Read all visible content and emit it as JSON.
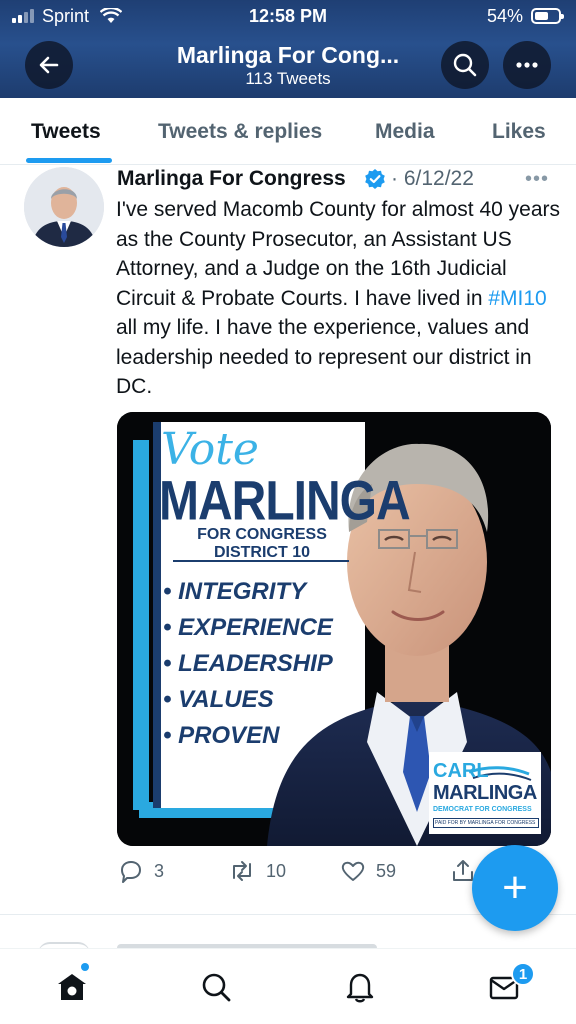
{
  "status_bar": {
    "carrier": "Sprint",
    "time": "12:58 PM",
    "battery": "54%"
  },
  "header": {
    "title": "Marlinga For Cong...",
    "subtitle": "113 Tweets"
  },
  "tabs": [
    {
      "label": "Tweets",
      "active": true
    },
    {
      "label": "Tweets & replies",
      "active": false
    },
    {
      "label": "Media",
      "active": false
    },
    {
      "label": "Likes",
      "active": false
    }
  ],
  "tweet": {
    "author": "Marlinga For Congress",
    "date": "· 6/12/22",
    "more": "•••",
    "text_before": "I've served Macomb County for almost 40 years as the County Prosecutor, an Assistant US Attorney, and a Judge on the 16th Judicial Circuit & Probate Courts. I have lived in ",
    "hashtag": "#MI10",
    "text_after": " all my life. I have the experience, values and leadership needed to represent our district in DC.",
    "media": {
      "vote": "Vote",
      "name": "MARLINGA",
      "subtitle": "FOR CONGRESS DISTRICT 10",
      "bullets": [
        "INTEGRITY",
        "EXPERIENCE",
        "LEADERSHIP",
        "VALUES",
        "PROVEN"
      ],
      "logo_line1": "CARL",
      "logo_line2": "MARLINGA",
      "logo_line3": "DEMOCRAT FOR CONGRESS",
      "logo_line4": "PAID FOR BY MARLINGA FOR CONGRESS"
    },
    "actions": {
      "replies": "3",
      "retweets": "10",
      "likes": "59"
    }
  },
  "fab_label": "+",
  "nav": {
    "messages_badge": "1"
  },
  "colors": {
    "accent": "#1d9bf0",
    "header_bg": "#28508d",
    "poster_navy": "#1b3d6e",
    "poster_blue": "#2aa9e0"
  }
}
